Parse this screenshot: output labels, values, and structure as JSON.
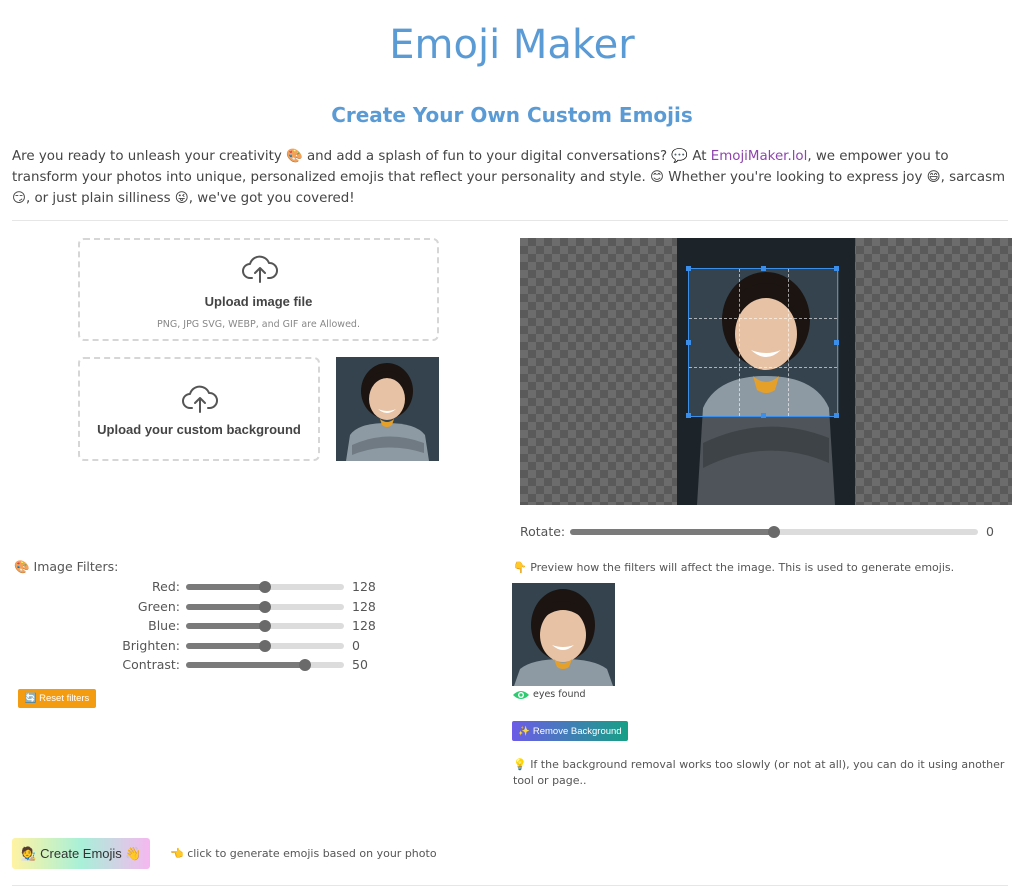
{
  "header": {
    "title": "Emoji Maker",
    "subtitle": "Create Your Own Custom Emojis"
  },
  "intro": {
    "part1": "Are you ready to unleash your creativity 🎨 and add a splash of fun to your digital conversations? 💬 At ",
    "link": "EmojiMaker.lol",
    "part2": ", we empower you to transform your photos into unique, personalized emojis that reflect your personality and style. 😊 Whether you're looking to express joy 😄, sarcasm 😏, or just plain silliness 😜, we've got you covered!"
  },
  "upload": {
    "file_label": "Upload image file",
    "file_hint": "PNG, JPG SVG, WEBP, and GIF are Allowed.",
    "bg_label": "Upload your custom background"
  },
  "rotate": {
    "label": "Rotate:",
    "value": "0",
    "level": 0.5
  },
  "filters": {
    "title": "🎨 Image Filters:",
    "items": [
      {
        "label": "Red:",
        "value": "128",
        "level": 0.5
      },
      {
        "label": "Green:",
        "value": "128",
        "level": 0.5
      },
      {
        "label": "Blue:",
        "value": "128",
        "level": 0.5
      },
      {
        "label": "Brighten:",
        "value": "0",
        "level": 0.5
      },
      {
        "label": "Contrast:",
        "value": "50",
        "level": 0.75
      }
    ],
    "reset_label": "🔄 Reset filters"
  },
  "preview": {
    "note": "👇 Preview how the filters will affect the image. This is used to generate emojis.",
    "eyes_label": "eyes found",
    "remove_bg_label": "✨ Remove Background",
    "tip": "💡 If the background removal works too slowly (or not at all), you can do it using another tool or page.."
  },
  "create": {
    "button_label": "🧑‍🎨 Create Emojis 👋",
    "hint": "👈 click to generate emojis based on your photo"
  },
  "colors": {
    "accent": "#5b9bd5",
    "link": "#8e44ad",
    "reset_btn": "#f39c12",
    "remove_btn_start": "#6c5ce7",
    "remove_btn_end": "#16a085"
  }
}
